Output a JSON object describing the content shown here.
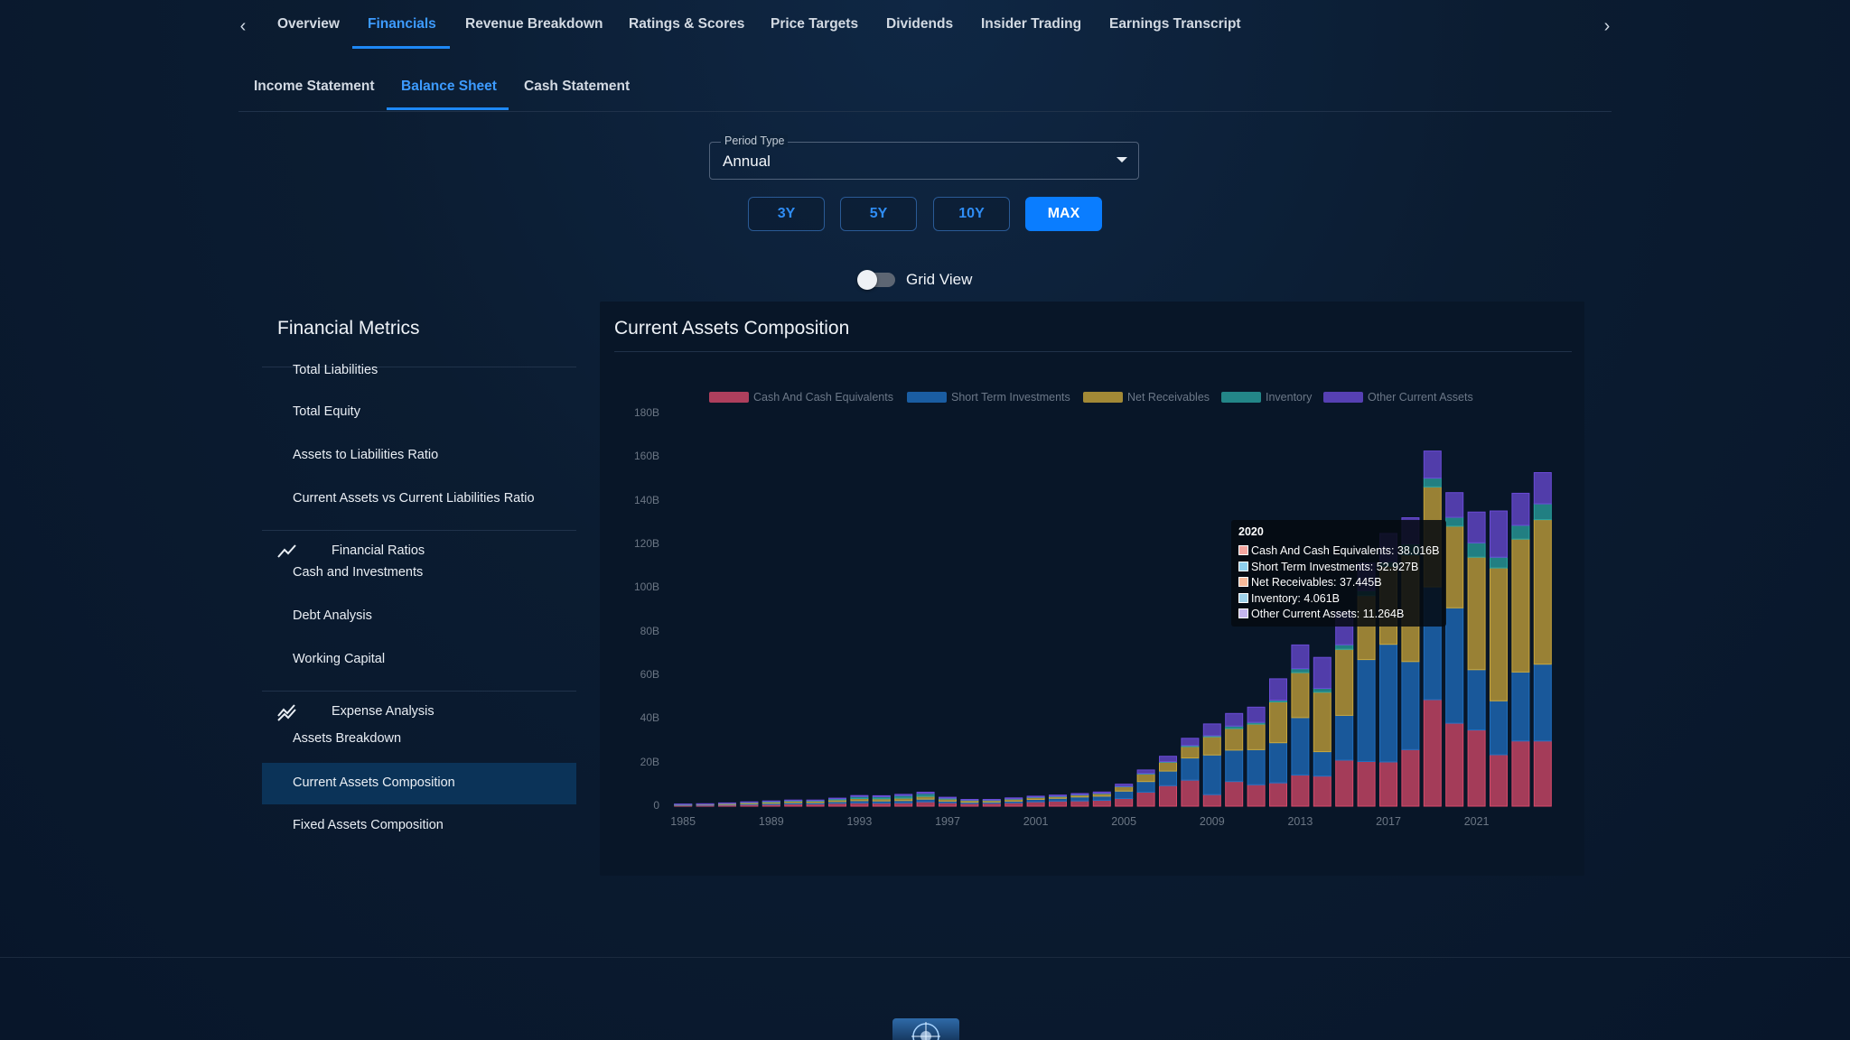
{
  "top_nav": {
    "tabs": [
      "Overview",
      "Financials",
      "Revenue Breakdown",
      "Ratings & Scores",
      "Price Targets",
      "Dividends",
      "Insider Trading",
      "Earnings Transcript"
    ],
    "active": "Financials",
    "prev_icon": "chevron-left-icon",
    "next_icon": "chevron-right-icon"
  },
  "sub_nav": {
    "tabs": [
      "Income Statement",
      "Balance Sheet",
      "Cash Statement"
    ],
    "active": "Balance Sheet"
  },
  "period": {
    "label": "Period Type",
    "value": "Annual"
  },
  "ranges": {
    "items": [
      "3Y",
      "5Y",
      "10Y",
      "MAX"
    ],
    "active": "MAX"
  },
  "grid_view": {
    "label": "Grid View",
    "on": false
  },
  "sidebar": {
    "title": "Financial Metrics",
    "items": [
      {
        "label": "Total Liabilities"
      },
      {
        "label": "Total Equity"
      },
      {
        "label": "Assets to Liabilities Ratio"
      },
      {
        "label": "Current Assets vs Current Liabilities Ratio"
      },
      {
        "label": "Financial Ratios",
        "group": true,
        "icon": "trending-up-icon"
      },
      {
        "label": "Cash and Investments"
      },
      {
        "label": "Debt Analysis"
      },
      {
        "label": "Working Capital"
      },
      {
        "label": "Expense Analysis",
        "group": true,
        "icon": "trending-double-icon"
      },
      {
        "label": "Assets Breakdown"
      },
      {
        "label": "Current Assets Composition",
        "active": true
      },
      {
        "label": "Fixed Assets Composition"
      }
    ]
  },
  "chart": {
    "title": "Current Assets Composition"
  },
  "tooltip": {
    "title": "2020",
    "rows": [
      "Cash And Cash Equivalents: 38.016B",
      "Short Term Investments: 52.927B",
      "Net Receivables: 37.445B",
      "Inventory: 4.061B",
      "Other Current Assets: 11.264B"
    ],
    "colors": [
      "#f4a7a0",
      "#8fd0ef",
      "#f6b99a",
      "#9fd2ea",
      "#c6b6ee"
    ]
  },
  "chart_data": {
    "type": "bar",
    "stacked": true,
    "title": "Current Assets Composition",
    "ylim": [
      0,
      180
    ],
    "yticks": [
      "0",
      "20B",
      "40B",
      "60B",
      "80B",
      "100B",
      "120B",
      "140B",
      "160B",
      "180B"
    ],
    "xtick_labels": [
      "1985",
      "1989",
      "1993",
      "1997",
      "2001",
      "2005",
      "2009",
      "2013",
      "2017",
      "2021"
    ],
    "legend_position": "top",
    "grid": false,
    "categories": [
      "1985",
      "1986",
      "1987",
      "1988",
      "1989",
      "1990",
      "1991",
      "1992",
      "1993",
      "1994",
      "1995",
      "1996",
      "1997",
      "1998",
      "1999",
      "2000",
      "2001",
      "2002",
      "2003",
      "2004",
      "2005",
      "2006",
      "2007",
      "2008",
      "2009",
      "2010",
      "2011",
      "2012",
      "2013",
      "2014",
      "2015",
      "2016",
      "2017",
      "2018",
      "2019",
      "2020",
      "2021",
      "2022",
      "2023",
      "2024"
    ],
    "series": [
      {
        "name": "Cash And Cash Equivalents",
        "color": "#d84a6a",
        "values": [
          0.3,
          0.4,
          0.5,
          0.7,
          0.8,
          1.0,
          1.0,
          1.3,
          1.5,
          1.4,
          1.5,
          2.0,
          1.5,
          1.2,
          1.3,
          1.5,
          2.0,
          2.3,
          2.4,
          2.7,
          3.5,
          6.4,
          9.4,
          11.9,
          5.3,
          11.3,
          9.8,
          10.7,
          14.3,
          13.8,
          21.1,
          20.5,
          20.3,
          25.9,
          48.8,
          38.0,
          34.9,
          23.6,
          29.9,
          29.9
        ]
      },
      {
        "name": "Short Term Investments",
        "color": "#1f6fc0",
        "values": [
          0.2,
          0.2,
          0.3,
          0.4,
          0.5,
          0.6,
          0.6,
          0.8,
          1.0,
          1.0,
          1.1,
          1.2,
          0.8,
          0.6,
          0.6,
          0.8,
          1.1,
          1.3,
          1.8,
          1.9,
          3.4,
          4.9,
          6.7,
          10.2,
          18.2,
          14.4,
          16.1,
          18.4,
          26.3,
          11.2,
          20.5,
          46.7,
          53.9,
          40.4,
          51.7,
          52.9,
          27.7,
          24.7,
          31.6,
          35.2
        ]
      },
      {
        "name": "Net Receivables",
        "color": "#c9a63a",
        "values": [
          0.3,
          0.3,
          0.4,
          0.5,
          0.6,
          0.7,
          0.7,
          0.8,
          1.0,
          1.0,
          1.1,
          1.3,
          1.0,
          0.8,
          0.8,
          1.0,
          1.0,
          0.9,
          1.0,
          1.2,
          2.0,
          3.4,
          4.0,
          5.2,
          8.3,
          9.9,
          11.7,
          18.7,
          20.6,
          27.2,
          30.3,
          29.3,
          35.7,
          48.9,
          45.8,
          37.4,
          51.5,
          60.9,
          60.9,
          66.2
        ]
      },
      {
        "name": "Inventory",
        "color": "#2aa3a0",
        "values": [
          0.1,
          0.1,
          0.2,
          0.2,
          0.3,
          0.3,
          0.3,
          0.5,
          1.0,
          1.0,
          1.2,
          1.3,
          0.4,
          0.2,
          0.1,
          0.1,
          0.1,
          0.1,
          0.1,
          0.1,
          0.2,
          0.3,
          0.3,
          0.5,
          0.5,
          1.1,
          0.8,
          0.8,
          1.8,
          1.8,
          2.1,
          2.3,
          2.1,
          4.9,
          4.1,
          4.1,
          6.6,
          4.9,
          6.3,
          7.3
        ]
      },
      {
        "name": "Other Current Assets",
        "color": "#6a4bd6",
        "values": [
          0.1,
          0.1,
          0.1,
          0.2,
          0.2,
          0.2,
          0.2,
          0.3,
          0.4,
          0.4,
          0.5,
          0.6,
          0.4,
          0.3,
          0.3,
          0.4,
          0.4,
          0.5,
          0.5,
          0.6,
          1.0,
          1.6,
          2.5,
          3.3,
          5.4,
          5.8,
          7.0,
          9.8,
          10.9,
          14.2,
          15.1,
          12.6,
          13.0,
          12.1,
          12.4,
          11.3,
          14.1,
          21.2,
          14.7,
          14.3
        ]
      }
    ]
  }
}
